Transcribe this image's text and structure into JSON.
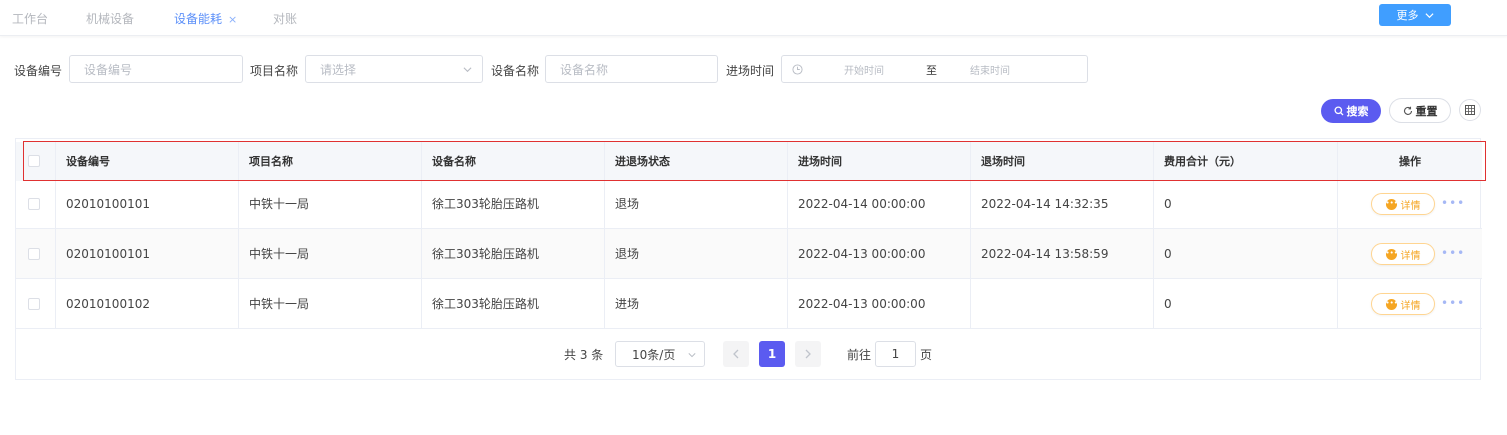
{
  "tabs": [
    {
      "label": "工作台",
      "active": false
    },
    {
      "label": "机械设备",
      "active": false
    },
    {
      "label": "设备能耗",
      "active": true
    },
    {
      "label": "对账",
      "active": false
    }
  ],
  "tab_close_glyph": "×",
  "more_button": {
    "label": "更多",
    "icon": "chevron-down-icon"
  },
  "filters": {
    "device_no": {
      "label": "设备编号",
      "placeholder": "设备编号"
    },
    "project": {
      "label": "项目名称",
      "placeholder": "请选择"
    },
    "device_name": {
      "label": "设备名称",
      "placeholder": "设备名称"
    },
    "entry_time": {
      "label": "进场时间",
      "start_placeholder": "开始时间",
      "separator": "至",
      "end_placeholder": "结束时间"
    }
  },
  "actions": {
    "search_label": "搜索",
    "reset_label": "重置"
  },
  "table": {
    "headers": [
      "设备编号",
      "项目名称",
      "设备名称",
      "进退场状态",
      "进场时间",
      "退场时间",
      "费用合计（元）",
      "操作"
    ],
    "rows": [
      {
        "device_no": "02010100101",
        "project": "中铁十一局",
        "device_name": "徐工303轮胎压路机",
        "status": "退场",
        "entry_time": "2022-04-14 00:00:00",
        "exit_time": "2022-04-14 14:32:35",
        "cost": "0"
      },
      {
        "device_no": "02010100101",
        "project": "中铁十一局",
        "device_name": "徐工303轮胎压路机",
        "status": "退场",
        "entry_time": "2022-04-13 00:00:00",
        "exit_time": "2022-04-14 13:58:59",
        "cost": "0"
      },
      {
        "device_no": "02010100102",
        "project": "中铁十一局",
        "device_name": "徐工303轮胎压路机",
        "status": "进场",
        "entry_time": "2022-04-13 00:00:00",
        "exit_time": "",
        "cost": "0"
      }
    ],
    "detail_label": "详情",
    "more_glyph": "•••"
  },
  "pagination": {
    "total_text": "共 3 条",
    "page_size": "10条/页",
    "current_page": "1",
    "goto_label": "前往",
    "goto_value": "1",
    "page_suffix": "页"
  },
  "colors": {
    "accent": "#5b5bf0",
    "tab_active": "#5b8ff9",
    "more_button": "#409eff",
    "highlight_border": "#e03131",
    "detail": "#f5a623"
  }
}
